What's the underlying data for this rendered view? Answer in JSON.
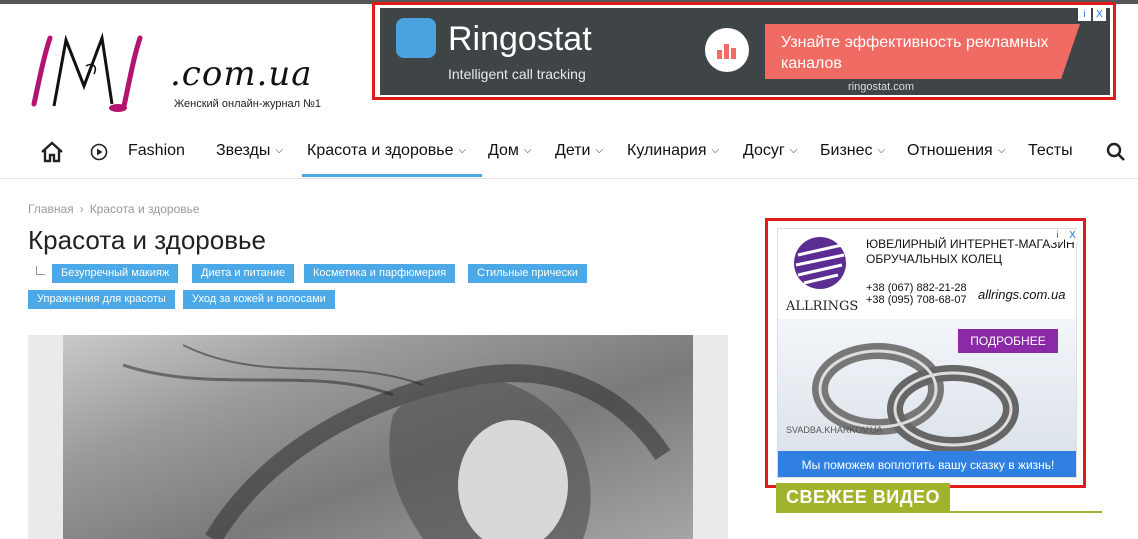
{
  "site": {
    "logo_text": ".com.ua",
    "tagline": "Женский онлайн-журнал №1"
  },
  "ad_top": {
    "brand": "Ringostat",
    "subtitle": "Intelligent call tracking",
    "cta": "Узнайте эффективность рекламных каналов",
    "domain": "ringostat.com",
    "choices": [
      "i",
      "X"
    ]
  },
  "nav": {
    "items": [
      {
        "label": "Fashion",
        "dropdown": false
      },
      {
        "label": "Звезды",
        "dropdown": true
      },
      {
        "label": "Красота и здоровье",
        "dropdown": true,
        "active": true
      },
      {
        "label": "Дом",
        "dropdown": true
      },
      {
        "label": "Дети",
        "dropdown": true
      },
      {
        "label": "Кулинария",
        "dropdown": true
      },
      {
        "label": "Досуг",
        "dropdown": true
      },
      {
        "label": "Бизнес",
        "dropdown": true
      },
      {
        "label": "Отношения",
        "dropdown": true
      },
      {
        "label": "Тесты",
        "dropdown": false
      }
    ],
    "accent": "#4aa9e6"
  },
  "breadcrumb": {
    "home": "Главная",
    "current": "Красота и здоровье"
  },
  "page_title": "Красота и здоровье",
  "subcategories": [
    "Безупречный макияж",
    "Диета и питание",
    "Косметика и парфюмерия",
    "Стильные прически",
    "Упражнения для красоты",
    "Уход за кожей и волосами"
  ],
  "ad_side": {
    "brand": "ALLRINGS",
    "heading": "ЮВЕЛИРНЫЙ ИНТЕРНЕТ-МАГАЗИН ОБРУЧАЛЬНЫХ КОЛЕЦ",
    "phone1": "+38 (067) 882-21-28",
    "phone2": "+38 (095) 708-68-07",
    "site": "allrings.com.ua",
    "more": "ПОДРОБНЕЕ",
    "watermark": "SVADBA.KHARKOV.UA",
    "bottom": "Мы поможем воплотить вашу сказку в жизнь!",
    "choices": [
      "i",
      "X"
    ]
  },
  "fresh_video": "СВЕЖЕЕ ВИДЕО",
  "colors": {
    "ad_border": "#e01b1b",
    "tag_bg": "#4aa9e6",
    "video_accent": "#a1b32a"
  }
}
